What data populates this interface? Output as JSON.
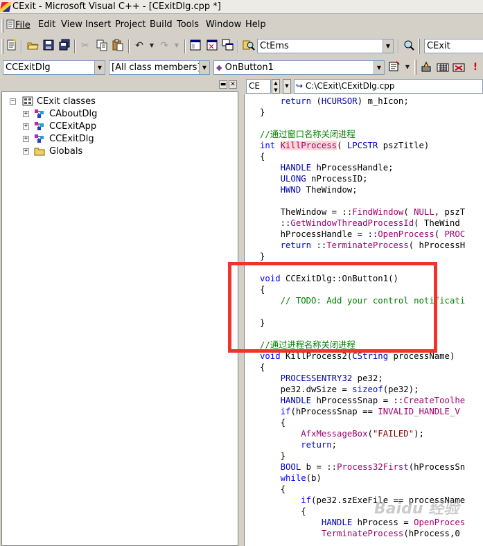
{
  "window": {
    "title": "CExit - Microsoft Visual C++ - [CExitDlg.cpp *]"
  },
  "menu": [
    "File",
    "Edit",
    "View",
    "Insert",
    "Project",
    "Build",
    "Tools",
    "Window",
    "Help"
  ],
  "toolbar": {
    "find_combo": "CtEms",
    "workspace_combo": "CExit",
    "icons": [
      "new-text-file-icon",
      "open-icon",
      "save-icon",
      "save-all-icon",
      "cut-icon",
      "copy-icon",
      "paste-icon",
      "undo-icon",
      "redo-icon",
      "workspace-icon",
      "output-icon",
      "window-list-icon",
      "find-in-files-icon",
      "compile-icon",
      "build-icon",
      "stop-build-icon",
      "go-icon"
    ]
  },
  "wizardbar": {
    "class": "CCExitDlg",
    "filter": "[All class members]",
    "member": "OnButton1"
  },
  "classview": {
    "root": "CExit classes",
    "items": [
      "CAboutDlg",
      "CCExitApp",
      "CCExitDlg",
      "Globals"
    ]
  },
  "editor": {
    "file_combo": "CE",
    "path": "C:\\CExit\\CExitDlg.cpp"
  },
  "colors": {
    "keyword": "#0000ff",
    "comment": "#008000",
    "macro": "#a00070",
    "string": "#800000",
    "highlight_box": "#f0342c"
  },
  "code_lines": [
    [
      [
        "    ",
        ""
      ],
      [
        "return",
        "kw"
      ],
      [
        " (",
        ""
      ],
      [
        "HCURSOR",
        "tp"
      ],
      [
        ") m_hIcon;",
        ""
      ]
    ],
    [
      [
        "}",
        ""
      ]
    ],
    [
      [
        "",
        ""
      ]
    ],
    [
      [
        "//通过窗口名称关闭进程",
        "cm"
      ]
    ],
    [
      [
        "int",
        "kw"
      ],
      [
        " ",
        ""
      ],
      [
        "KillProcess",
        "hl"
      ],
      [
        "( ",
        ""
      ],
      [
        "LPCSTR",
        "tp"
      ],
      [
        " pszTitle)",
        ""
      ]
    ],
    [
      [
        "{",
        ""
      ]
    ],
    [
      [
        "    ",
        ""
      ],
      [
        "HANDLE",
        "tp"
      ],
      [
        " hProcessHandle;",
        ""
      ]
    ],
    [
      [
        "    ",
        ""
      ],
      [
        "ULONG",
        "tp"
      ],
      [
        " nProcessID;",
        ""
      ]
    ],
    [
      [
        "    ",
        ""
      ],
      [
        "HWND",
        "tp"
      ],
      [
        " TheWindow;",
        ""
      ]
    ],
    [
      [
        "",
        ""
      ]
    ],
    [
      [
        "    TheWindow = ::",
        ""
      ],
      [
        "FindWindow",
        "mc"
      ],
      [
        "( ",
        ""
      ],
      [
        "NULL",
        "mc"
      ],
      [
        ", pszT",
        ""
      ]
    ],
    [
      [
        "    ::",
        ""
      ],
      [
        "GetWindowThreadProcessId",
        "mc"
      ],
      [
        "( TheWind",
        ""
      ]
    ],
    [
      [
        "    hProcessHandle = ::",
        ""
      ],
      [
        "OpenProcess",
        "mc"
      ],
      [
        "( ",
        ""
      ],
      [
        "PROC",
        "mc"
      ]
    ],
    [
      [
        "    ",
        ""
      ],
      [
        "return",
        "kw"
      ],
      [
        " ::",
        ""
      ],
      [
        "TerminateProcess",
        "mc"
      ],
      [
        "( hProcessH",
        ""
      ]
    ],
    [
      [
        "}",
        ""
      ]
    ],
    [
      [
        "",
        ""
      ]
    ],
    [
      [
        "void",
        "kw"
      ],
      [
        " CCExitDlg::OnButton1()",
        ""
      ]
    ],
    [
      [
        "{",
        ""
      ]
    ],
    [
      [
        "    ",
        ""
      ],
      [
        "// TODO: Add your control notificati",
        "cm"
      ]
    ],
    [
      [
        "",
        ""
      ]
    ],
    [
      [
        "}",
        ""
      ]
    ],
    [
      [
        "",
        ""
      ]
    ],
    [
      [
        "//通过进程名称关闭进程",
        "cm"
      ]
    ],
    [
      [
        "void",
        "kw"
      ],
      [
        " KillProcess2(",
        ""
      ],
      [
        "CString",
        "tp"
      ],
      [
        " processName)",
        ""
      ]
    ],
    [
      [
        "{",
        ""
      ]
    ],
    [
      [
        "    ",
        ""
      ],
      [
        "PROCESSENTRY32",
        "tp"
      ],
      [
        " pe32;",
        ""
      ]
    ],
    [
      [
        "    pe32.dwSize = ",
        ""
      ],
      [
        "sizeof",
        "kw"
      ],
      [
        "(pe32);",
        ""
      ]
    ],
    [
      [
        "    ",
        ""
      ],
      [
        "HANDLE",
        "tp"
      ],
      [
        " hProcessSnap = ::",
        ""
      ],
      [
        "CreateToolhe",
        "mc"
      ]
    ],
    [
      [
        "    ",
        ""
      ],
      [
        "if",
        "kw"
      ],
      [
        "(hProcessSnap == ",
        ""
      ],
      [
        "INVALID_HANDLE_V",
        "mc"
      ]
    ],
    [
      [
        "    {",
        ""
      ]
    ],
    [
      [
        "        ",
        ""
      ],
      [
        "AfxMessageBox",
        "mc"
      ],
      [
        "(",
        ""
      ],
      [
        "\"FAILED\"",
        "st"
      ],
      [
        ");",
        ""
      ]
    ],
    [
      [
        "        ",
        ""
      ],
      [
        "return",
        "kw"
      ],
      [
        ";",
        ""
      ]
    ],
    [
      [
        "    }",
        ""
      ]
    ],
    [
      [
        "    ",
        ""
      ],
      [
        "BOOL",
        "tp"
      ],
      [
        " b = ::",
        ""
      ],
      [
        "Process32First",
        "mc"
      ],
      [
        "(hProcessSn",
        ""
      ]
    ],
    [
      [
        "    ",
        ""
      ],
      [
        "while",
        "kw"
      ],
      [
        "(b)",
        ""
      ]
    ],
    [
      [
        "    {",
        ""
      ]
    ],
    [
      [
        "        ",
        ""
      ],
      [
        "if",
        "kw"
      ],
      [
        "(pe32.szExeFile == processName",
        ""
      ]
    ],
    [
      [
        "        {",
        ""
      ]
    ],
    [
      [
        "            ",
        ""
      ],
      [
        "HANDLE",
        "tp"
      ],
      [
        " hProcess = ",
        ""
      ],
      [
        "OpenProces",
        "mc"
      ]
    ],
    [
      [
        "            ",
        ""
      ],
      [
        "TerminateProcess",
        "mc"
      ],
      [
        "(hProcess,0",
        ""
      ]
    ]
  ],
  "watermark": "Baidu 经验"
}
